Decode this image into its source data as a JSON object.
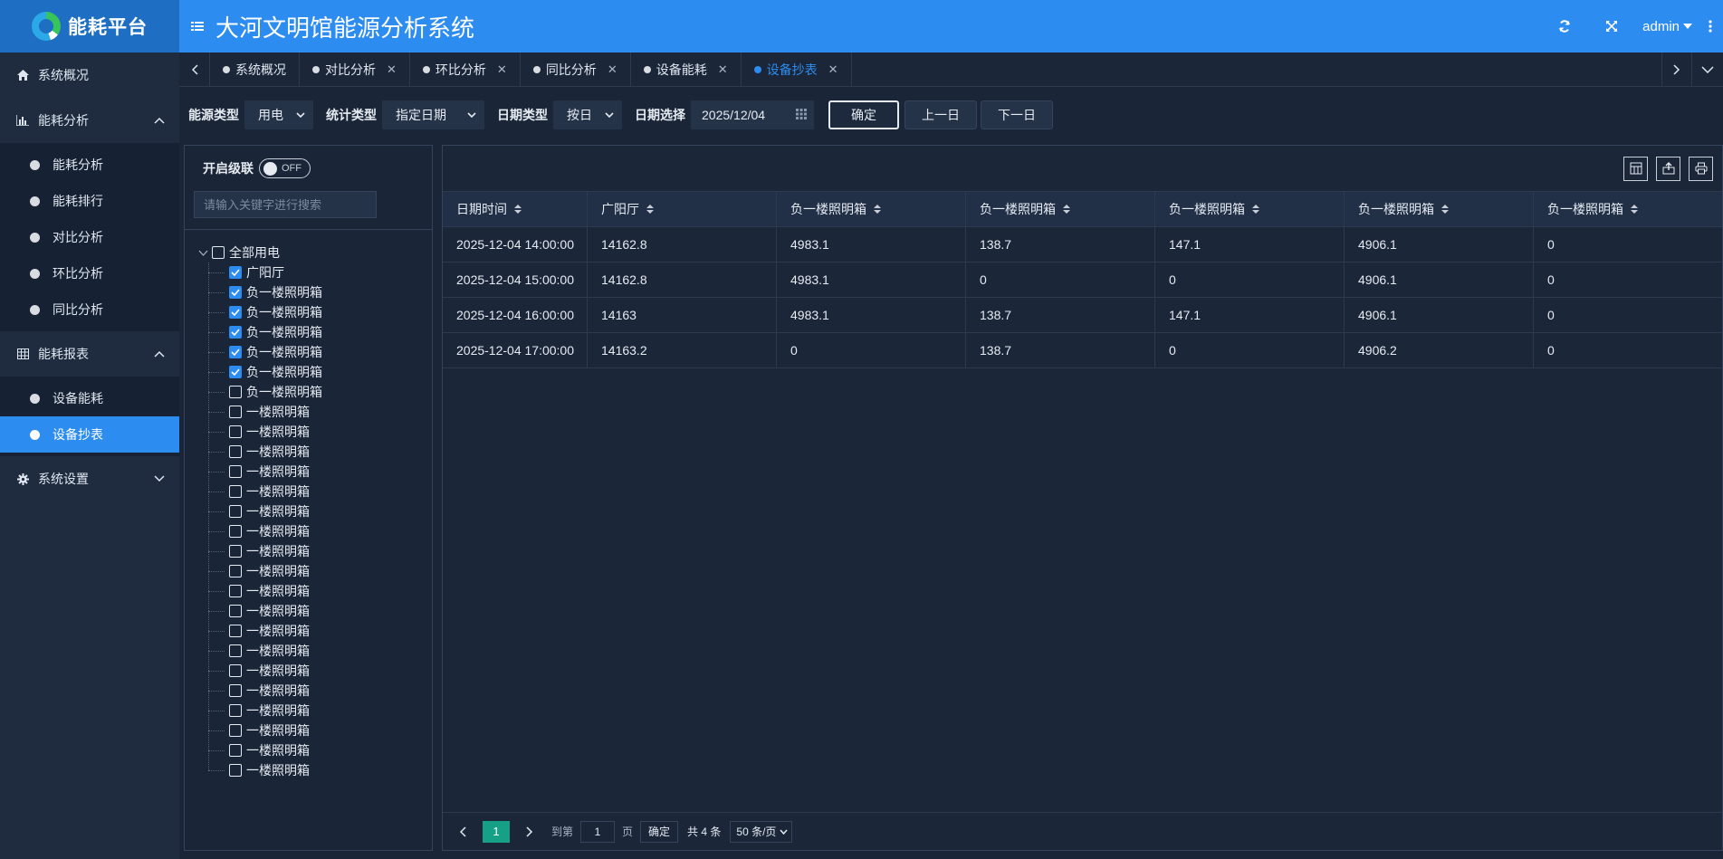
{
  "header": {
    "logo_text": "能耗平台",
    "title": "大河文明馆能源分析系统",
    "user": "admin"
  },
  "sidebar": {
    "items": [
      {
        "label": "系统概况",
        "icon": "home-icon"
      },
      {
        "label": "能耗分析",
        "icon": "bar-chart-icon",
        "children": [
          "能耗分析",
          "能耗排行",
          "对比分析",
          "环比分析",
          "同比分析"
        ]
      },
      {
        "label": "能耗报表",
        "icon": "table-icon",
        "children": [
          "设备能耗",
          "设备抄表"
        ]
      },
      {
        "label": "系统设置",
        "icon": "gear-icon"
      }
    ],
    "active_item": "设备抄表"
  },
  "tabs": [
    {
      "label": "系统概况",
      "closable": false
    },
    {
      "label": "对比分析",
      "closable": true
    },
    {
      "label": "环比分析",
      "closable": true
    },
    {
      "label": "同比分析",
      "closable": true
    },
    {
      "label": "设备能耗",
      "closable": true
    },
    {
      "label": "设备抄表",
      "closable": true,
      "active": true
    }
  ],
  "filters": {
    "energy_type_label": "能源类型",
    "energy_type_value": "用电",
    "stat_type_label": "统计类型",
    "stat_type_value": "指定日期",
    "date_type_label": "日期类型",
    "date_type_value": "按日",
    "date_select_label": "日期选择",
    "date_value": "2025/12/04",
    "confirm_label": "确定",
    "prev_label": "上一日",
    "next_label": "下一日"
  },
  "tree": {
    "cascade_label": "开启级联",
    "cascade_state": "OFF",
    "search_placeholder": "请输入关键字进行搜索",
    "root_label": "全部用电",
    "nodes": [
      {
        "label": "广阳厅",
        "checked": true
      },
      {
        "label": "负一楼照明箱",
        "checked": true
      },
      {
        "label": "负一楼照明箱",
        "checked": true
      },
      {
        "label": "负一楼照明箱",
        "checked": true
      },
      {
        "label": "负一楼照明箱",
        "checked": true
      },
      {
        "label": "负一楼照明箱",
        "checked": true
      },
      {
        "label": "负一楼照明箱",
        "checked": false
      },
      {
        "label": "一楼照明箱",
        "checked": false
      },
      {
        "label": "一楼照明箱",
        "checked": false
      },
      {
        "label": "一楼照明箱",
        "checked": false
      },
      {
        "label": "一楼照明箱",
        "checked": false
      },
      {
        "label": "一楼照明箱",
        "checked": false
      },
      {
        "label": "一楼照明箱",
        "checked": false
      },
      {
        "label": "一楼照明箱",
        "checked": false
      },
      {
        "label": "一楼照明箱",
        "checked": false
      },
      {
        "label": "一楼照明箱",
        "checked": false
      },
      {
        "label": "一楼照明箱",
        "checked": false
      },
      {
        "label": "一楼照明箱",
        "checked": false
      },
      {
        "label": "一楼照明箱",
        "checked": false
      },
      {
        "label": "一楼照明箱",
        "checked": false
      },
      {
        "label": "一楼照明箱",
        "checked": false
      },
      {
        "label": "一楼照明箱",
        "checked": false
      },
      {
        "label": "一楼照明箱",
        "checked": false
      },
      {
        "label": "一楼照明箱",
        "checked": false
      },
      {
        "label": "一楼照明箱",
        "checked": false
      },
      {
        "label": "一楼照明箱",
        "checked": false
      }
    ]
  },
  "table": {
    "columns": [
      "日期时间",
      "广阳厅",
      "负一楼照明箱",
      "负一楼照明箱",
      "负一楼照明箱",
      "负一楼照明箱",
      "负一楼照明箱"
    ],
    "rows": [
      [
        "2025-12-04 14:00:00",
        "14162.8",
        "4983.1",
        "138.7",
        "147.1",
        "4906.1",
        "0"
      ],
      [
        "2025-12-04 15:00:00",
        "14162.8",
        "4983.1",
        "0",
        "0",
        "4906.1",
        "0"
      ],
      [
        "2025-12-04 16:00:00",
        "14163",
        "4983.1",
        "138.7",
        "147.1",
        "4906.1",
        "0"
      ],
      [
        "2025-12-04 17:00:00",
        "14163.2",
        "0",
        "138.7",
        "0",
        "4906.2",
        "0"
      ]
    ]
  },
  "pager": {
    "current_page": "1",
    "goto_label": "到第",
    "goto_value": "1",
    "page_unit": "页",
    "confirm_label": "确定",
    "total_text": "共 4 条",
    "page_size": "50 条/页"
  },
  "colors": {
    "accent": "#2d8cf0",
    "page_active": "#16a085",
    "background": "#1a2638"
  }
}
